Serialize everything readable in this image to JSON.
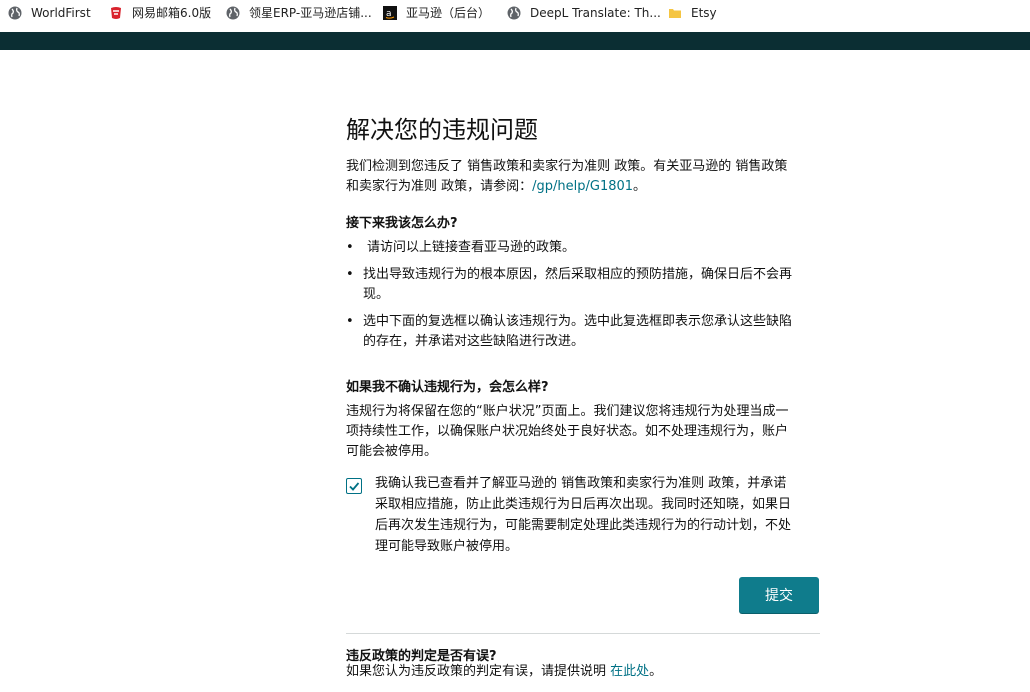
{
  "bookmarks": [
    {
      "label": "WorldFirst",
      "icon": "globe-icon"
    },
    {
      "label": "网易邮箱6.0版",
      "icon": "netease-mail-icon"
    },
    {
      "label": "领星ERP-亚马逊店铺...",
      "icon": "globe-icon"
    },
    {
      "label": "亚马逊（后台）",
      "icon": "amazon-icon"
    },
    {
      "label": "DeepL Translate: Th...",
      "icon": "globe-icon"
    },
    {
      "label": "Etsy",
      "icon": "folder-icon"
    }
  ],
  "colors": {
    "topbar": "#0b2e33",
    "link": "#007185",
    "button": "#0f7c8c"
  },
  "page": {
    "title": "解决您的违规问题",
    "intro_line1": "我们检测到您违反了 销售政策和卖家行为准则 政策。有关亚马逊的 销售政策",
    "intro_line2_prefix": "和卖家行为准则 政策，请参阅：",
    "intro_link": "/gp/help/G1801",
    "intro_line2_suffix": "。",
    "next_heading": "接下来我该怎么办?",
    "bullets": [
      "请访问以上链接查看亚马逊的政策。",
      "找出导致违规行为的根本原因，然后采取相应的预防措施，确保日后不会再现。",
      "选中下面的复选框以确认该违规行为。选中此复选框即表示您承认这些缺陷的存在，并承诺对这些缺陷进行改进。"
    ],
    "bullet_lines": [
      [
        "请访问以上链接查看亚马逊的政策。"
      ],
      [
        "找出导致违规行为的根本原因，然后采取相应的预防措施，确保日后不会再",
        "现。"
      ],
      [
        "选中下面的复选框以确认该违规行为。选中此复选框即表示您承认这些缺陷",
        "的存在，并承诺对这些缺陷进行改进。"
      ]
    ],
    "no_confirm_heading": "如果我不确认违规行为，会怎么样?",
    "no_confirm_lines": [
      "违规行为将保留在您的“账户状况”页面上。我们建议您将违规行为处理当成一",
      "项持续性工作，以确保账户状况始终处于良好状态。如不处理违规行为，账户",
      "可能会被停用。"
    ],
    "checkbox_checked": true,
    "checkbox_lines": [
      "我确认我已查看并了解亚马逊的 销售政策和卖家行为准则 政策，并承诺",
      "采取相应措施，防止此类违规行为日后再次出现。我同时还知晓，如果日",
      "后再次发生违规行为，可能需要制定处理此类违规行为的行动计划，不处",
      "理可能导致账户被停用。"
    ],
    "submit_label": "提交",
    "appeal_heading": "违反政策的判定是否有误?",
    "appeal_text": "如果您认为违反政策的判定有误，请提供说明 ",
    "appeal_link": "在此处",
    "appeal_suffix": "。"
  }
}
